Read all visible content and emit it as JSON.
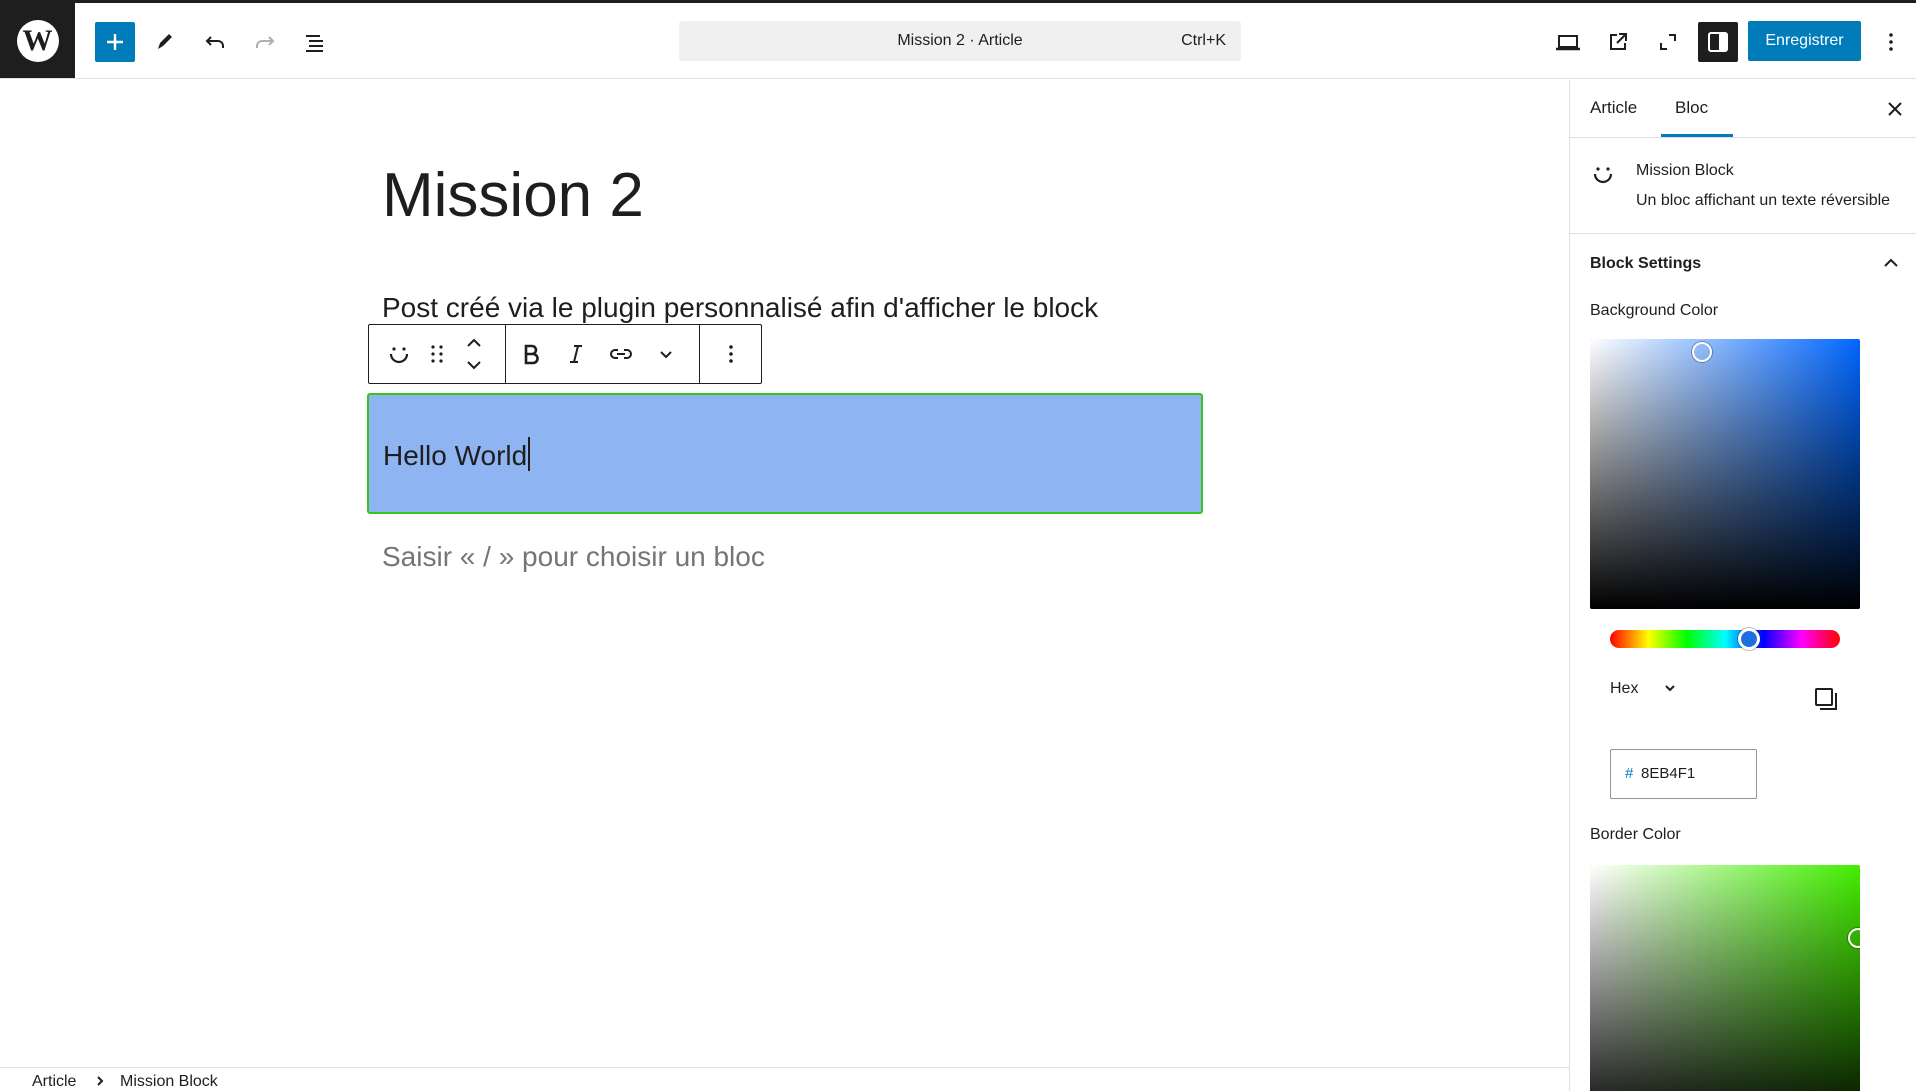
{
  "header": {
    "document_title": "Mission 2 · Article",
    "command_shortcut": "Ctrl+K",
    "save_label": "Enregistrer"
  },
  "editor": {
    "post_title": "Mission 2",
    "paragraph": "Post créé via le plugin personnalisé afin d'afficher le block",
    "mission_block_text": "Hello World",
    "mission_block_background": "#8EB4F1",
    "mission_block_border": "#39C220",
    "placeholder": "Saisir « / » pour choisir un bloc"
  },
  "footer": {
    "breadcrumb": [
      "Article",
      "Mission Block"
    ]
  },
  "sidebar": {
    "tabs": [
      "Article",
      "Bloc"
    ],
    "active_tab": "Bloc",
    "block_card": {
      "name": "Mission Block",
      "description": "Un bloc affichant un texte réversible"
    },
    "panel_title": "Block Settings",
    "background_color": {
      "label": "Background Color",
      "format": "Hex",
      "hex_prefix": "#",
      "value": "8EB4F1",
      "hue_color": "#0066FF"
    },
    "border_color": {
      "label": "Border Color",
      "hue_color": "#44EE00"
    }
  },
  "icons": [
    "wordpress-logo",
    "plus",
    "pencil",
    "undo",
    "redo",
    "document-overview",
    "desktop-view",
    "external-link",
    "fullscreen",
    "settings-sidebar",
    "more-vertical",
    "smile",
    "drag-handle",
    "move-up-down",
    "bold",
    "italic",
    "link",
    "chevron-down",
    "close",
    "chevron-up",
    "copy"
  ]
}
